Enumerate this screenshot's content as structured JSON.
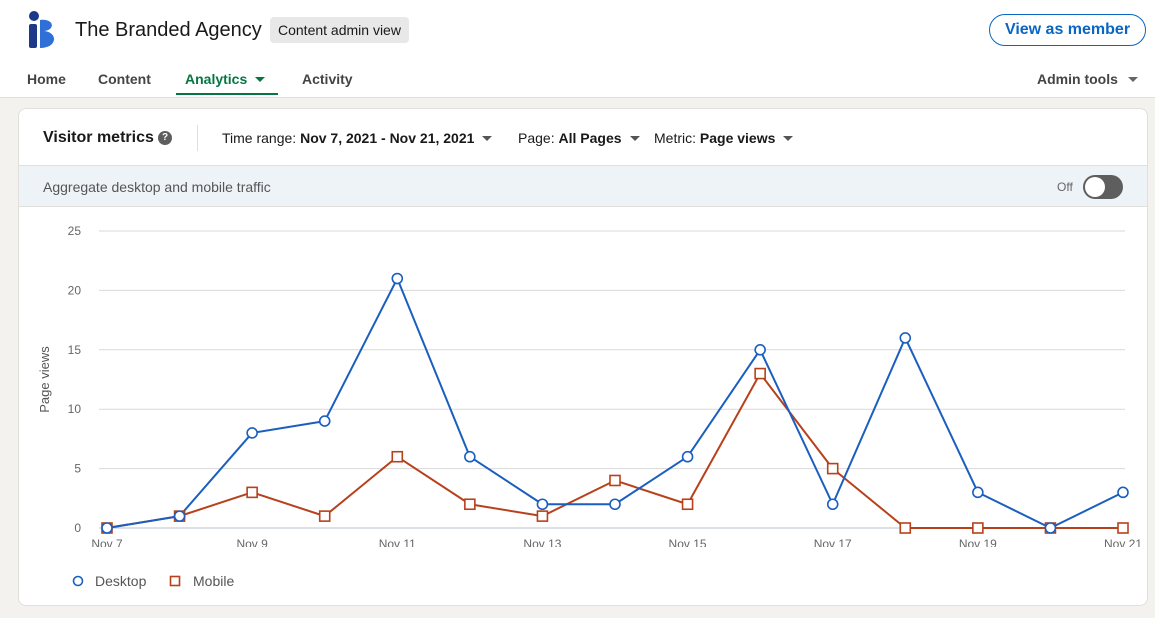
{
  "header": {
    "org_name": "The Branded Agency",
    "admin_badge": "Content admin view",
    "view_as_member": "View as member"
  },
  "nav": {
    "home": "Home",
    "content": "Content",
    "analytics": "Analytics",
    "activity": "Activity",
    "admin_tools": "Admin tools"
  },
  "card": {
    "title": "Visitor metrics",
    "help_glyph": "?",
    "time_range_label": "Time range:",
    "time_range_value": "Nov 7, 2021 - Nov 21, 2021",
    "page_label": "Page:",
    "page_value": "All Pages",
    "metric_label": "Metric:",
    "metric_value": "Page views",
    "aggregate_text": "Aggregate desktop and mobile traffic",
    "toggle_state": "Off"
  },
  "colors": {
    "accent_green": "#057642",
    "brand_blue": "#0a66c2",
    "desktop_series": "#1a5fbf",
    "mobile_series": "#b7411b"
  },
  "icons": {
    "logo": "branded-agency-logo-icon",
    "help": "help-circle-icon",
    "dropdown": "caret-down-icon"
  },
  "chart_data": {
    "type": "line",
    "x": [
      "Nov 7",
      "Nov 8",
      "Nov 9",
      "Nov 10",
      "Nov 11",
      "Nov 12",
      "Nov 13",
      "Nov 14",
      "Nov 15",
      "Nov 16",
      "Nov 17",
      "Nov 18",
      "Nov 19",
      "Nov 20",
      "Nov 21"
    ],
    "x_tick_labels": [
      "Nov 7",
      "Nov 9",
      "Nov 11",
      "Nov 13",
      "Nov 15",
      "Nov 17",
      "Nov 19",
      "Nov 21"
    ],
    "ylabel": "Page views",
    "ylim": [
      0,
      25
    ],
    "y_ticks": [
      0,
      5,
      10,
      15,
      20,
      25
    ],
    "grid": true,
    "legend_position": "bottom-left",
    "series": [
      {
        "name": "Desktop",
        "marker": "circle",
        "values": [
          0,
          1,
          8,
          9,
          21,
          6,
          2,
          2,
          6,
          15,
          2,
          16,
          3,
          0,
          3
        ]
      },
      {
        "name": "Mobile",
        "marker": "square",
        "values": [
          0,
          1,
          3,
          1,
          6,
          2,
          1,
          4,
          2,
          13,
          5,
          0,
          0,
          0,
          0
        ]
      }
    ]
  }
}
